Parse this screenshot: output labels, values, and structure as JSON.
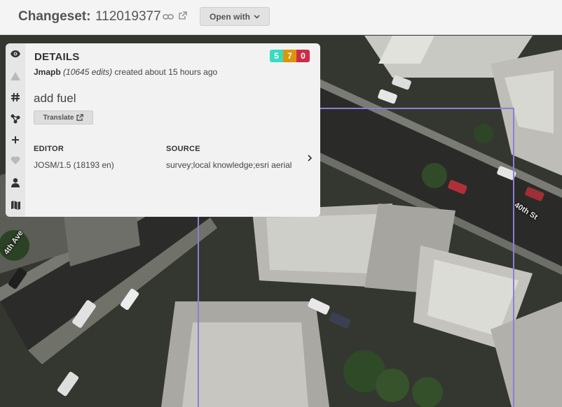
{
  "header": {
    "title_label": "Changeset:",
    "changeset_id": "112019377",
    "open_with_label": "Open with"
  },
  "panel": {
    "title": "DETAILS",
    "counts": {
      "created": "5",
      "modified": "7",
      "deleted": "0"
    },
    "colors": {
      "created": "#39dbc0",
      "modified": "#db950a",
      "deleted": "#cc2c47"
    },
    "user": "Jmapb",
    "edits": "(10645 edits)",
    "created_text": "created about 15 hours ago",
    "comment": "add fuel",
    "translate_label": "Translate",
    "editor_label": "EDITOR",
    "editor_value": "JOSM/1.5 (18193 en)",
    "source_label": "SOURCE",
    "source_value": "survey;local knowledge;esri aerial"
  },
  "sidebar": {
    "icons": [
      "eye-icon",
      "warning-icon",
      "hashtag-icon",
      "discussion-icon",
      "plus-icon",
      "heart-icon",
      "user-icon",
      "map-icon"
    ]
  },
  "map": {
    "street_labels": [
      "40th St",
      "4th Ave"
    ],
    "bbox_color": "#8a7fd6"
  }
}
